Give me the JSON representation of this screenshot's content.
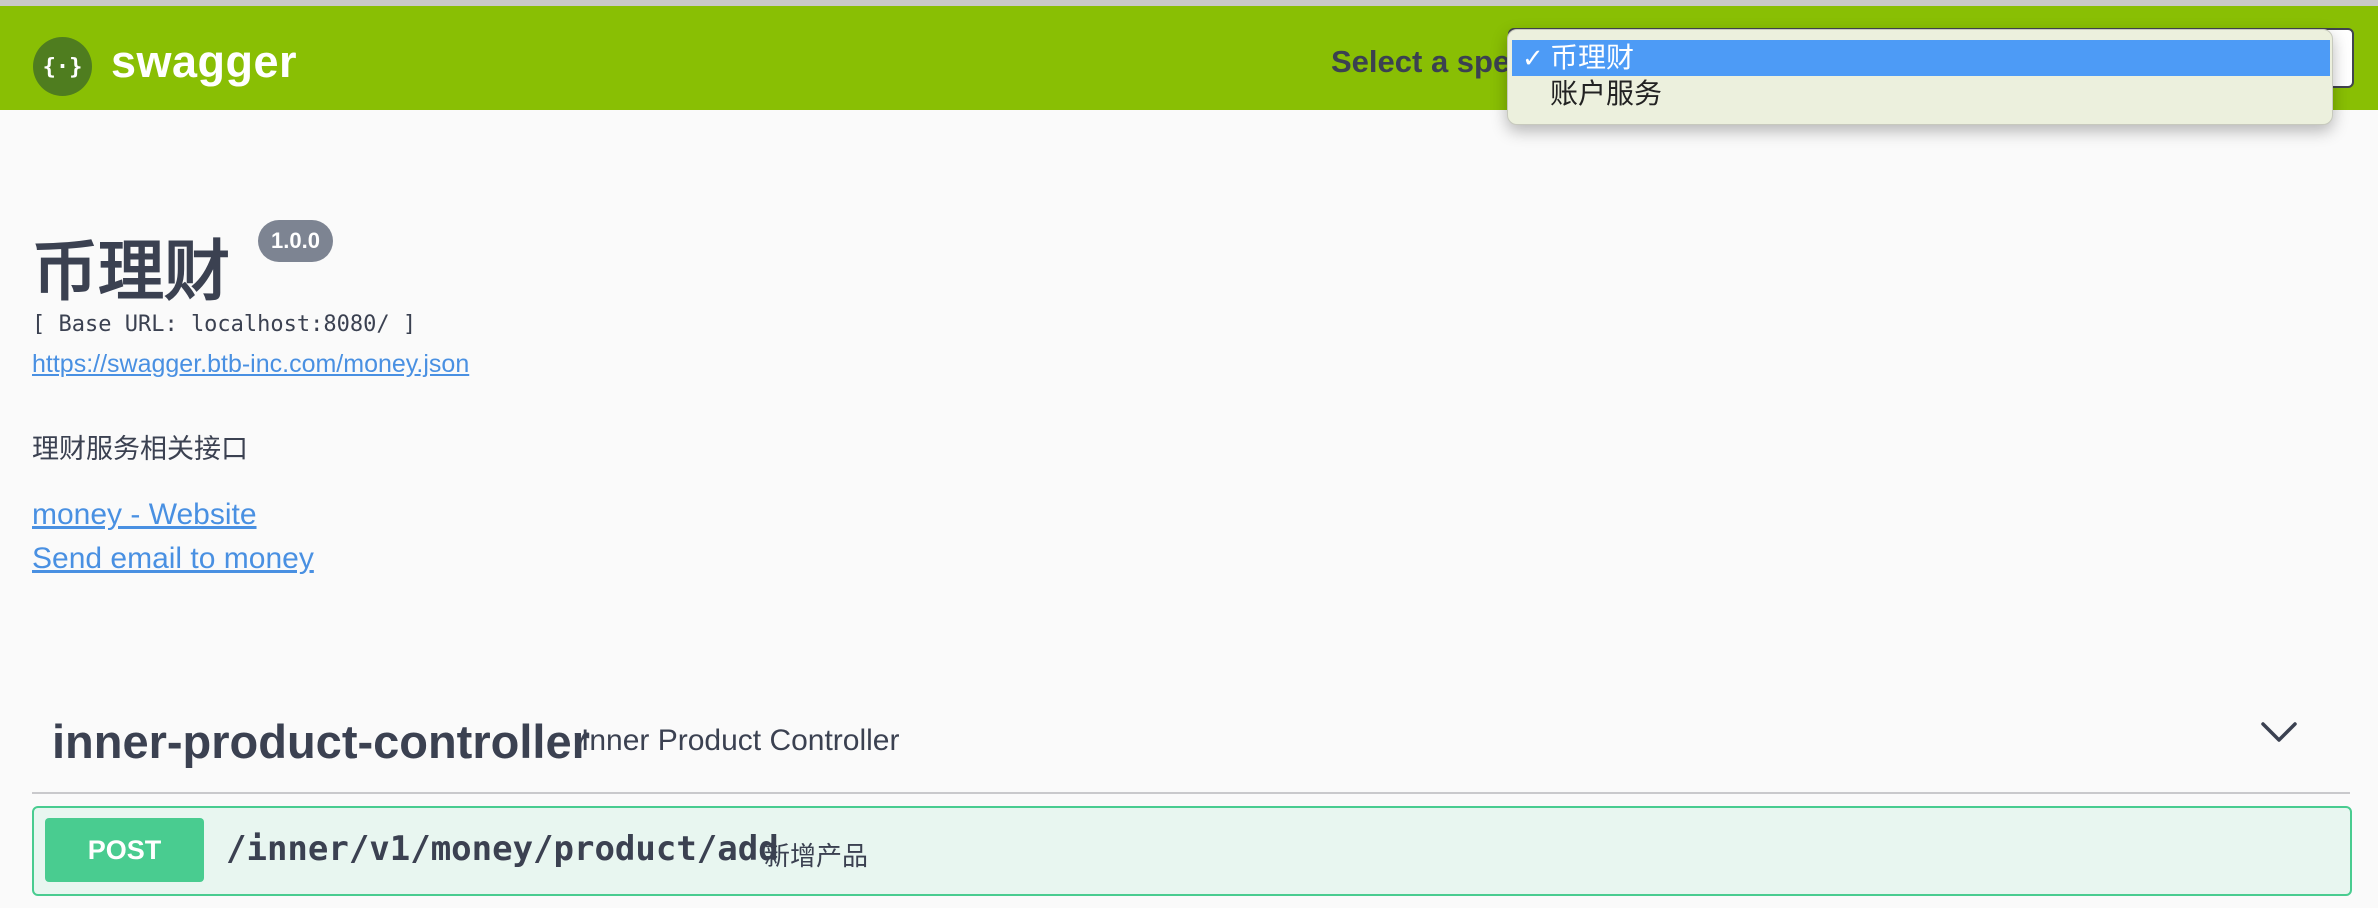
{
  "topbar": {
    "logo_text": "swagger",
    "logo_icon": "swagger-braces-icon",
    "spec_label": "Select a spec",
    "spec_options": [
      "币理财",
      "账户服务"
    ],
    "spec_selected": "币理财",
    "check_glyph": "✓",
    "brand_color": "#89bf04"
  },
  "info": {
    "title": "币理财",
    "version": "1.0.0",
    "base_url": "[ Base URL: localhost:8080/ ]",
    "spec_url": "https://swagger.btb-inc.com/money.json",
    "description": "理财服务相关接口",
    "website_link": "money - Website",
    "email_link": "Send email to money"
  },
  "tags": [
    {
      "name": "inner-product-controller",
      "description": "Inner Product Controller",
      "expanded_icon": "chevron-down-icon",
      "operations": [
        {
          "method": "POST",
          "path": "/inner/v1/money/product/add",
          "summary": "新增产品",
          "color": "#49cc90"
        }
      ]
    }
  ]
}
